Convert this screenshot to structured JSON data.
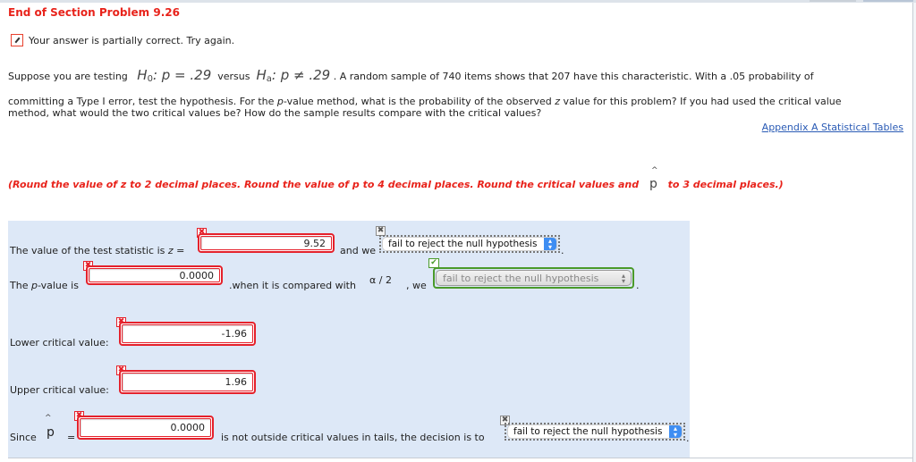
{
  "header": {
    "title": "End of Section Problem 9.26",
    "status_icon": "partially-correct-icon",
    "status_text": "Your answer is partially correct.  Try again."
  },
  "problem": {
    "intro": "Suppose you are testing",
    "h0_label": "H",
    "h0_sub": "0",
    "h0_expr": ": p = .29",
    "versus": "versus",
    "ha_label": "H",
    "ha_sub": "a",
    "ha_expr": ": p ≠ .29",
    "line1_rest": ". A random sample of 740 items shows that 207 have this characteristic. With a .05 probability of",
    "line2_a": "committing a Type I error, test the hypothesis. For the ",
    "line2_p": "p",
    "line2_b": "-value method, what is the probability of the observed ",
    "line2_z": "z",
    "line2_c": " value for this problem? If you had used the critical value",
    "line3": "method, what would the two critical values be? How do the sample results compare with the critical values?",
    "appendix_link": "Appendix A Statistical Tables"
  },
  "instructions": {
    "part1": "(Round the value of z to 2 decimal places. Round the value of p to 4 decimal places. Round the critical values and",
    "phat_symbol": "p",
    "phat_hat": "^",
    "part2": "to 3 decimal places.)"
  },
  "answers": {
    "z_label": "The value of the test statistic is ",
    "z_var": "z",
    "z_eq": " =",
    "z_value": "9.52",
    "z_status": "incorrect",
    "and_we": "and we",
    "decision1": "fail to reject the null hypothesis",
    "decision1_status": "unmarked",
    "p_label_a": "The ",
    "p_label_p": "p",
    "p_label_b": "-value is",
    "p_value": "0.0000",
    "p_status": "incorrect",
    "compared": ".when it is compared with",
    "alpha_expr": "α / 2",
    "we": ", we",
    "decision2": "fail to reject the null hypothesis",
    "decision2_status": "correct",
    "lower_label": "Lower critical value:",
    "lower_value": "-1.96",
    "lower_status": "incorrect",
    "upper_label": "Upper critical value:",
    "upper_value": "1.96",
    "upper_status": "incorrect",
    "since_label": "Since",
    "phat_symbol": "p",
    "phat_hat": "^",
    "eq": "=",
    "phat_value": "0.0000",
    "phat_status": "incorrect",
    "since_rest": "is not outside critical values in tails, the decision is to",
    "decision3": "fail to reject the null hypothesis",
    "decision3_status": "unmarked",
    "period": "."
  },
  "marks": {
    "incorrect": "✖",
    "correct": "✔",
    "unmarked": "✖"
  },
  "colors": {
    "title_red": "#e8231b",
    "incorrect_red": "#e5212b",
    "correct_green": "#4a9a2a",
    "panel_bg": "#dde8f7",
    "link_blue": "#2a5bb5",
    "select_blue": "#3f8ef2"
  }
}
